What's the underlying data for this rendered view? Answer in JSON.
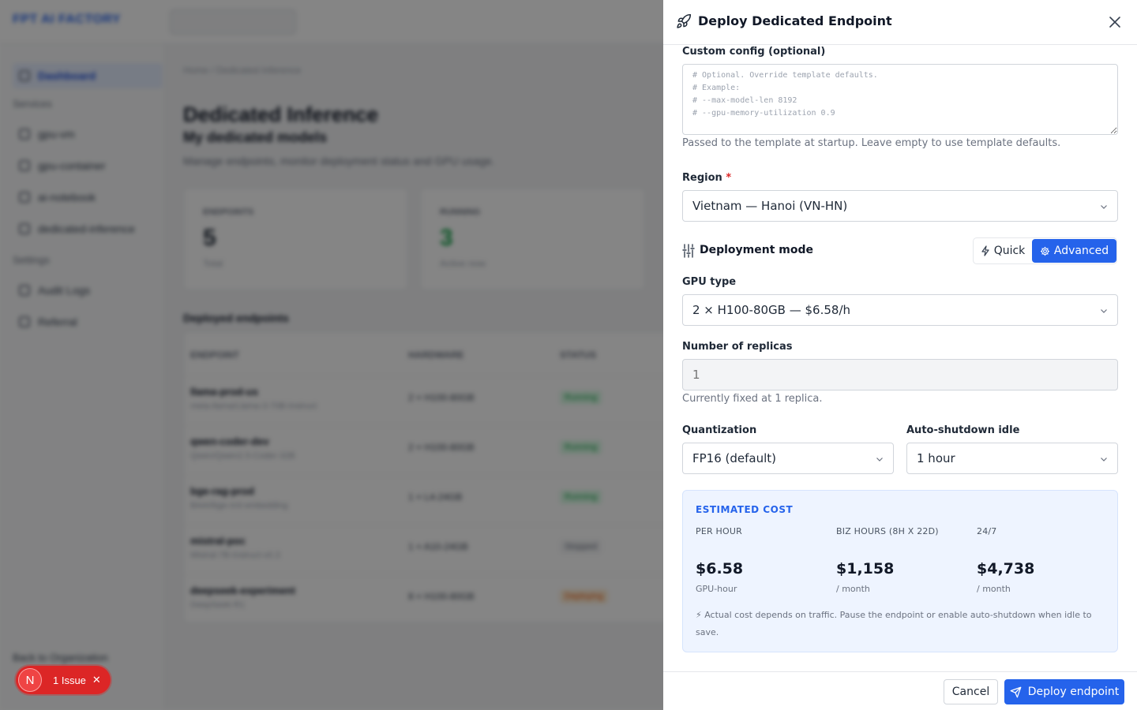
{
  "background": {
    "logo": "FPT AI FACTORY",
    "nav_dashboard": "Dashboard",
    "section_services": "Services",
    "nav_items": [
      "gpu-vm",
      "gpu-container",
      "ai-notebook",
      "dedicated-inference"
    ],
    "section_settings": "Settings",
    "settings_items": [
      "Audit Logs",
      "Referral"
    ],
    "breadcrumb": "Home / Dedicated Inference",
    "page_title": "Dedicated Inference",
    "page_subtitle": "My dedicated models",
    "page_description": "Manage endpoints, monitor deployment status and GPU usage.",
    "card_endpoints": {
      "label": "ENDPOINTS",
      "value": "5",
      "sub": "Total"
    },
    "card_running": {
      "label": "RUNNING",
      "value": "3",
      "sub": "Active now"
    },
    "table_title": "Deployed endpoints",
    "table_headers": [
      "ENDPOINT",
      "HARDWARE",
      "STATUS"
    ],
    "rows": [
      {
        "name": "llama-prod-us",
        "sub": "meta-llama/Llama-3-70B-Instruct",
        "hw": "2 × H100-80GB",
        "status": "Running"
      },
      {
        "name": "qwen-coder-dev",
        "sub": "Qwen/Qwen2.5-Coder-32B",
        "hw": "2 × H100-80GB",
        "status": "Running"
      },
      {
        "name": "bge-rag-prod",
        "sub": "BAAI/bge-m3-embedding",
        "hw": "1 × L4-24GB",
        "status": "Running"
      },
      {
        "name": "mistral-poc",
        "sub": "Mistral-7B-Instruct-v0.3",
        "hw": "1 × A10-24GB",
        "status": "Stopped"
      },
      {
        "name": "deepseek-experiment",
        "sub": "DeepSeek-R1",
        "hw": "8 × H100-80GB",
        "status": "Deploying"
      }
    ],
    "back_link": "Back to Organization"
  },
  "issue_badge": {
    "avatar": "N",
    "label": "1 Issue"
  },
  "drawer": {
    "title": "Deploy Dedicated Endpoint",
    "custom_config": {
      "label": "Custom config (optional)",
      "placeholder": "# Optional. Override template defaults.\n# Example:\n# --max-model-len 8192\n# --gpu-memory-utilization 0.9",
      "help": "Passed to the template at startup. Leave empty to use template defaults."
    },
    "region": {
      "label": "Region",
      "required_mark": "*",
      "value": "Vietnam — Hanoi (VN-HN)"
    },
    "deployment_mode": {
      "label": "Deployment mode",
      "quick": "Quick",
      "advanced": "Advanced",
      "selected": "Advanced"
    },
    "gpu_type": {
      "label": "GPU type",
      "value": "2 × H100-80GB — $6.58/h"
    },
    "replicas": {
      "label": "Number of replicas",
      "placeholder": "1",
      "help": "Currently fixed at 1 replica."
    },
    "quantization": {
      "label": "Quantization",
      "value": "FP16 (default)"
    },
    "auto_shutdown": {
      "label": "Auto-shutdown idle",
      "value": "1 hour"
    },
    "cost": {
      "title": "ESTIMATED COST",
      "per_hour": {
        "label": "PER HOUR",
        "value": "$6.58",
        "unit": "GPU-hour"
      },
      "biz_hours": {
        "label": "BIZ HOURS (8H X 22D)",
        "value": "$1,158",
        "unit": "/ month"
      },
      "always_on": {
        "label": "24/7",
        "value": "$4,738",
        "unit": "/ month"
      },
      "note": "⚡ Actual cost depends on traffic. Pause the endpoint or enable auto-shutdown when idle to save."
    },
    "footer": {
      "cancel": "Cancel",
      "deploy": "Deploy endpoint"
    }
  },
  "colors": {
    "accent": "#2563eb",
    "required": "#dc2626",
    "issue": "#dc2626",
    "cost_panel_bg": "#eef4ff"
  }
}
